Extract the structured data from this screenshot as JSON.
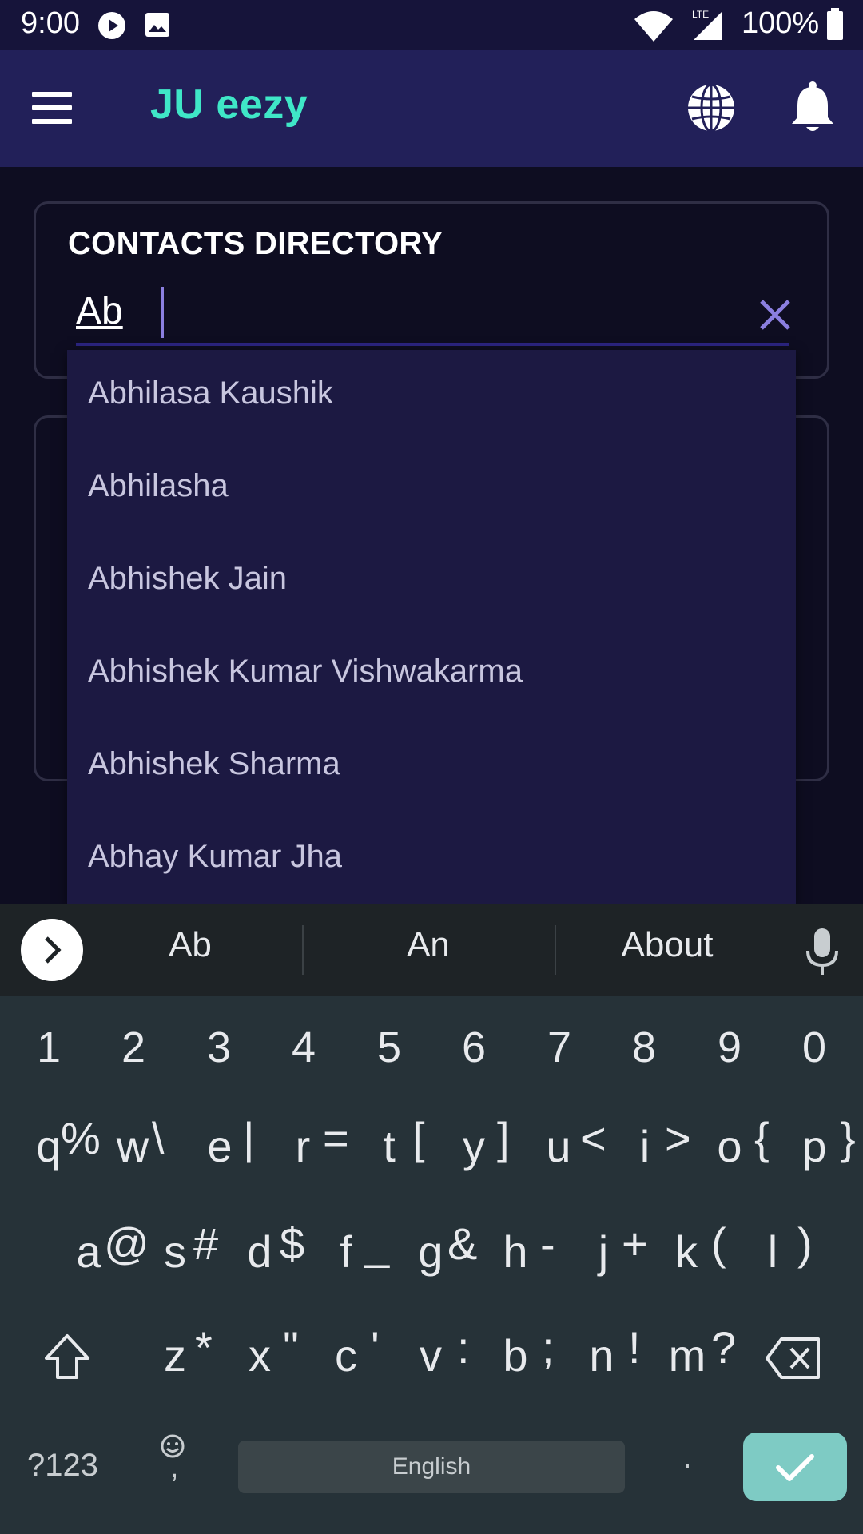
{
  "status_bar": {
    "time": "9:00",
    "battery": "100%"
  },
  "app_bar": {
    "title": "JU eezy"
  },
  "search_card": {
    "title": "CONTACTS DIRECTORY",
    "query": "Ab"
  },
  "dropdown": {
    "items": [
      "Abhilasa Kaushik",
      "Abhilasha",
      "Abhishek Jain",
      "Abhishek Kumar Vishwakarma",
      "Abhishek Sharma",
      "Abhay Kumar Jha"
    ]
  },
  "keyboard": {
    "suggestions": [
      "Ab",
      "An",
      "About"
    ],
    "numbers": [
      "1",
      "2",
      "3",
      "4",
      "5",
      "6",
      "7",
      "8",
      "9",
      "0"
    ],
    "row1": [
      "q",
      "w",
      "e",
      "r",
      "t",
      "y",
      "u",
      "i",
      "o",
      "p"
    ],
    "row1_sup": [
      "%",
      "\\",
      "|",
      "=",
      "[",
      "]",
      "<",
      ">",
      "{",
      "}"
    ],
    "row2": [
      "a",
      "s",
      "d",
      "f",
      "g",
      "h",
      "j",
      "k",
      "l"
    ],
    "row2_sup": [
      "@",
      "#",
      "$",
      "_",
      "&",
      "-",
      "+",
      "(",
      ")"
    ],
    "row3": [
      "z",
      "x",
      "c",
      "v",
      "b",
      "n",
      "m"
    ],
    "row3_sup": [
      "*",
      "\"",
      "'",
      ":",
      ";",
      "!",
      "?"
    ],
    "symbols_label": "?123",
    "comma": ",",
    "period": ".",
    "space_label": "English"
  },
  "colors": {
    "accent": "#3fe7c7",
    "appbar": "#222059",
    "dropdown": "#1c1942",
    "enter": "#7ecbc4"
  }
}
